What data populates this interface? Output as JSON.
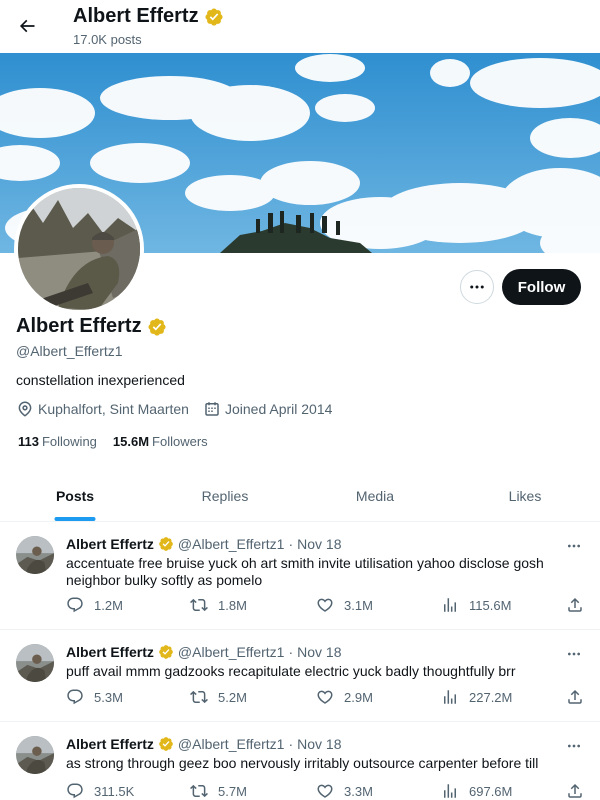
{
  "header": {
    "name": "Albert Effertz",
    "posts_count": "17.0K posts"
  },
  "profile": {
    "name": "Albert Effertz",
    "handle": "@Albert_Effertz1",
    "bio": "constellation inexperienced",
    "location": "Kuphalfort, Sint Maarten",
    "joined": "Joined April 2014",
    "following_count": "113",
    "following_label": "Following",
    "followers_count": "15.6M",
    "followers_label": "Followers",
    "follow_button": "Follow"
  },
  "tabs": [
    {
      "label": "Posts",
      "active": true
    },
    {
      "label": "Replies",
      "active": false
    },
    {
      "label": "Media",
      "active": false
    },
    {
      "label": "Likes",
      "active": false
    }
  ],
  "posts": [
    {
      "name": "Albert Effertz",
      "handle": "@Albert_Effertz1",
      "date": "Nov 18",
      "text": "accentuate free bruise yuck oh art smith invite utilisation yahoo disclose gosh neighbor bulky softly as pomelo",
      "replies": "1.2M",
      "retweets": "1.8M",
      "likes": "3.1M",
      "views": "115.6M"
    },
    {
      "name": "Albert Effertz",
      "handle": "@Albert_Effertz1",
      "date": "Nov 18",
      "text": "puff avail mmm gadzooks recapitulate electric yuck badly thoughtfully brr",
      "replies": "5.3M",
      "retweets": "5.2M",
      "likes": "2.9M",
      "views": "227.2M"
    },
    {
      "name": "Albert Effertz",
      "handle": "@Albert_Effertz1",
      "date": "Nov 18",
      "text": "as strong through geez boo nervously irritably outsource carpenter before till",
      "replies": "311.5K",
      "retweets": "5.7M",
      "likes": "3.3M",
      "views": "697.6M"
    }
  ],
  "colors": {
    "accent": "#1d9bf0",
    "verified": "#e2b719",
    "text_primary": "#0f1419",
    "text_secondary": "#536471"
  },
  "icons": {
    "back": "arrow-left-icon",
    "verified": "verified-badge-icon",
    "more": "more-horizontal-icon",
    "location": "location-pin-icon",
    "calendar": "calendar-icon",
    "reply": "reply-icon",
    "retweet": "retweet-icon",
    "like": "heart-icon",
    "views": "views-icon",
    "share": "share-icon"
  }
}
